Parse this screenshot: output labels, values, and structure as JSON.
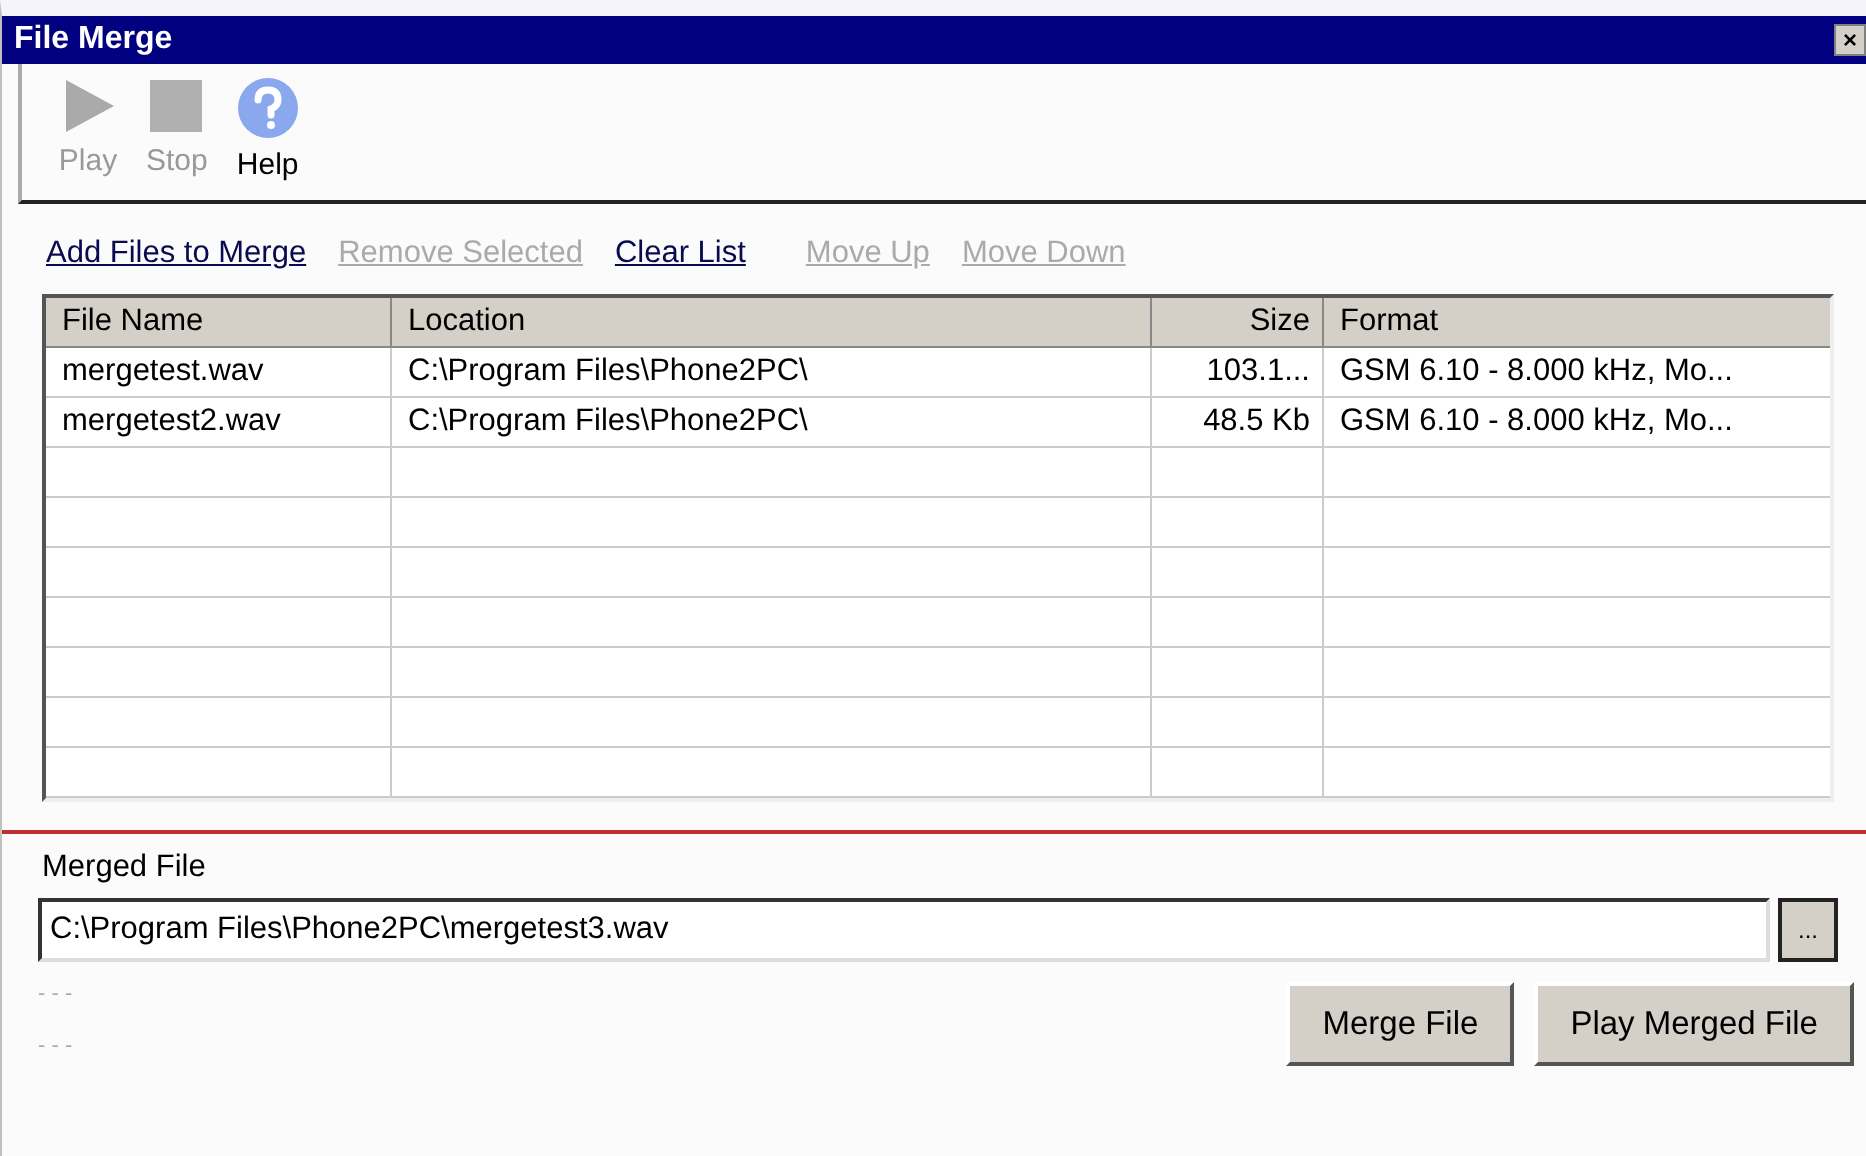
{
  "window": {
    "title": "File Merge",
    "close": "×"
  },
  "toolbar": [
    {
      "kind": "play",
      "label": "Play",
      "disabled": true
    },
    {
      "kind": "stop",
      "label": "Stop",
      "disabled": true
    },
    {
      "kind": "help",
      "label": "Help",
      "disabled": false
    }
  ],
  "actions": [
    {
      "label": "Add Files to Merge",
      "disabled": false
    },
    {
      "label": "Remove Selected",
      "disabled": true
    },
    {
      "label": "Clear List",
      "disabled": false
    },
    {
      "label": "Move Up",
      "disabled": true
    },
    {
      "label": "Move Down",
      "disabled": true
    }
  ],
  "table": {
    "columns": [
      "File Name",
      "Location",
      "Size",
      "Format"
    ],
    "rows": [
      [
        "mergetest.wav",
        "C:\\Program Files\\Phone2PC\\",
        "103.1...",
        "GSM 6.10 - 8.000 kHz, Mo..."
      ],
      [
        "mergetest2.wav",
        "C:\\Program Files\\Phone2PC\\",
        "48.5 Kb",
        "GSM 6.10 - 8.000 kHz, Mo..."
      ]
    ]
  },
  "merged_file": {
    "label": "Merged File",
    "value": "C:\\Program Files\\Phone2PC\\mergetest3.wav",
    "browse": "..."
  },
  "status": [
    "- - -",
    "- - -"
  ],
  "buttons": [
    "Merge File",
    "Play Merged File"
  ]
}
